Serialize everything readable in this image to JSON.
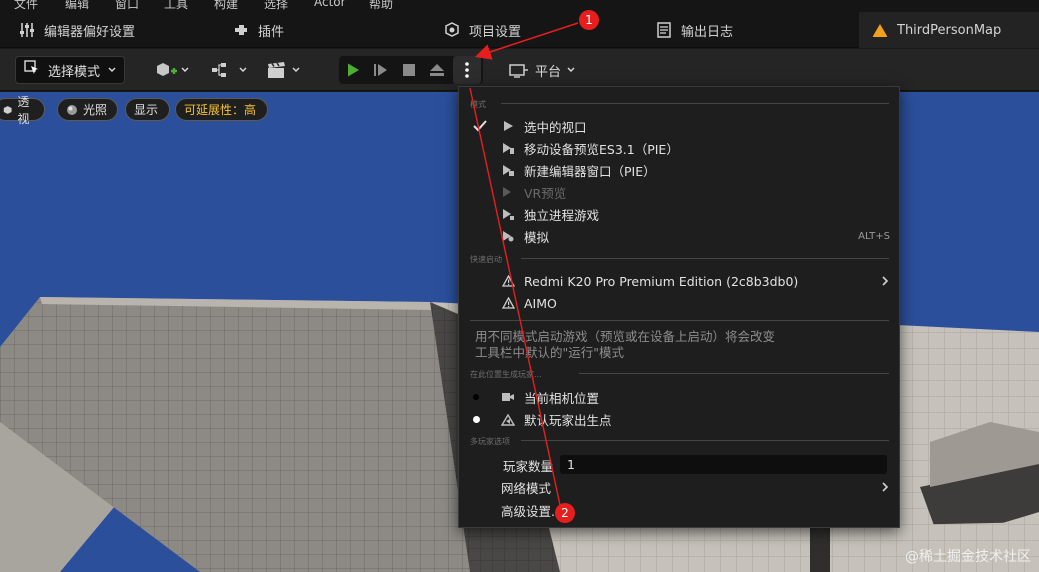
{
  "menubar": {
    "items": [
      "文件",
      "编辑",
      "窗口",
      "工具",
      "构建",
      "选择",
      "Actor",
      "帮助"
    ]
  },
  "tabs": [
    {
      "label": "编辑器偏好设置",
      "icon": "sliders-icon"
    },
    {
      "label": "插件",
      "icon": "plug-icon"
    },
    {
      "label": "项目设置",
      "icon": "cube-gear-icon"
    },
    {
      "label": "输出日志",
      "icon": "log-icon"
    },
    {
      "label": "ThirdPersonMap",
      "icon": "level-icon"
    }
  ],
  "toolbar": {
    "mode_label": "选择模式",
    "platform_label": "平台"
  },
  "viewport": {
    "pills": [
      "透视",
      "光照",
      "显示",
      "可延展性：高"
    ]
  },
  "dropdown": {
    "section_modes": "模式",
    "modes": [
      {
        "label": "选中的视口",
        "checked": true
      },
      {
        "label": "移动设备预览ES3.1（PIE）",
        "checked": false
      },
      {
        "label": "新建编辑器窗口（PIE）",
        "checked": false
      },
      {
        "label": "VR预览",
        "checked": false,
        "disabled": true
      },
      {
        "label": "独立进程游戏",
        "checked": false
      },
      {
        "label": "模拟",
        "checked": false,
        "shortcut": "ALT+S"
      }
    ],
    "section_quick": "快速启动",
    "devices": [
      {
        "label": "Redmi K20 Pro Premium Edition (2c8b3db0)",
        "submenu": true
      },
      {
        "label": "AIMO",
        "submenu": false
      }
    ],
    "description": "用不同模式启动游戏（预览或在设备上启动）将会改变工具栏中默认的\"运行\"模式",
    "section_spawn": "在此位置生成玩家...",
    "spawn": [
      {
        "label": "当前相机位置",
        "selected": false
      },
      {
        "label": "默认玩家出生点",
        "selected": true
      }
    ],
    "section_multi": "多玩家选项",
    "player_count_label": "玩家数量",
    "player_count_value": "1",
    "net_mode_label": "网络模式",
    "advanced_label": "高级设置..."
  },
  "annotations": {
    "badge1": "1",
    "badge2": "2"
  },
  "watermark": "@稀土掘金技术社区",
  "colors": {
    "play_green": "#4caf32",
    "annotation_red": "#e61e1e",
    "warning_yellow": "#f3c331",
    "sky_blue": "#2a4f9c"
  }
}
